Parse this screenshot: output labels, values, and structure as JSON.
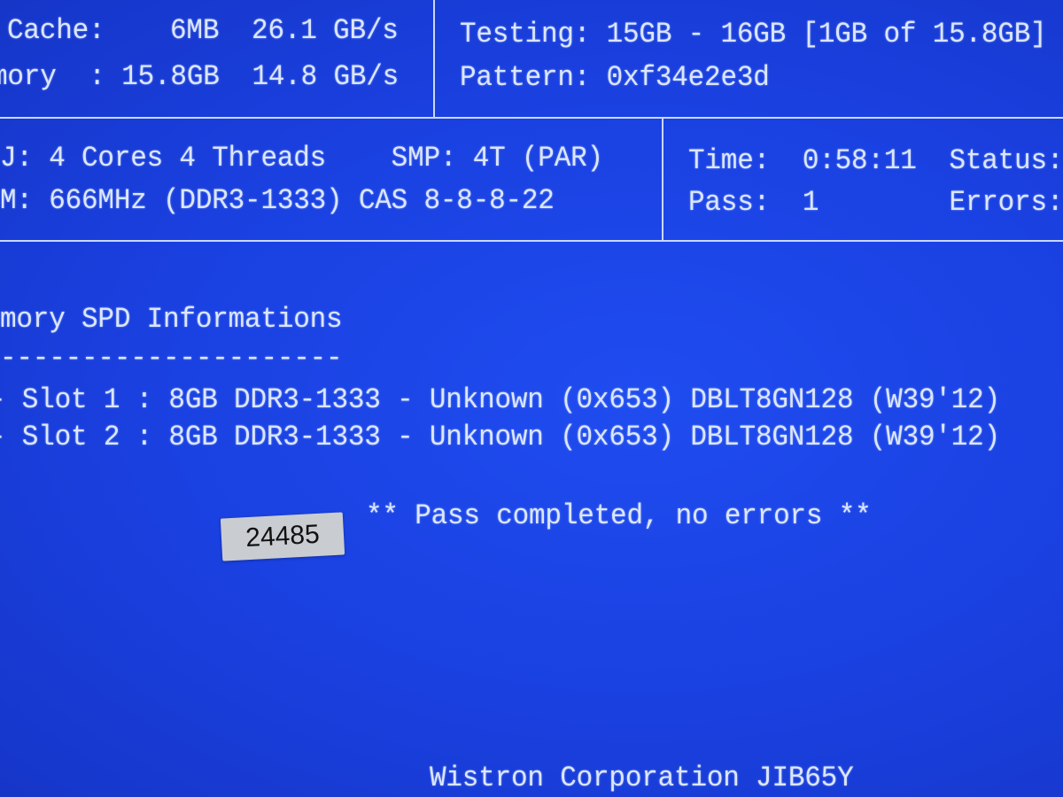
{
  "info_panel": {
    "cache_row": "Cache:    6MB  26.1 GB/s",
    "memory_row": "mory  : 15.8GB  14.8 GB/s"
  },
  "test_panel": {
    "testing": "Testing: 15GB - 16GB [1GB of 15.8GB]",
    "pattern": "Pattern: 0xf34e2e3d"
  },
  "system_panel": {
    "cpu_row": "J: 4 Cores 4 Threads    SMP: 4T (PAR)",
    "ram_row": "M: 666MHz (DDR3-1333) CAS 8-8-8-22"
  },
  "status_panel": {
    "time_row": "Time:  0:58:11  Status:",
    "pass_row": "Pass:  1        Errors:"
  },
  "spd": {
    "title": "mory SPD Informations",
    "divider": "---------------------",
    "slots": [
      "- Slot 1 : 8GB DDR3-1333 - Unknown (0x653) DBLT8GN128 (W39'12)",
      "- Slot 2 : 8GB DDR3-1333 - Unknown (0x653) DBLT8GN128 (W39'12)"
    ]
  },
  "result_message": "** Pass completed, no errors **",
  "sticker_label": "24485",
  "footer": "Wistron Corporation JIB65Y",
  "colors": {
    "background": "#1a40e0",
    "text": "#dbe6ff"
  }
}
